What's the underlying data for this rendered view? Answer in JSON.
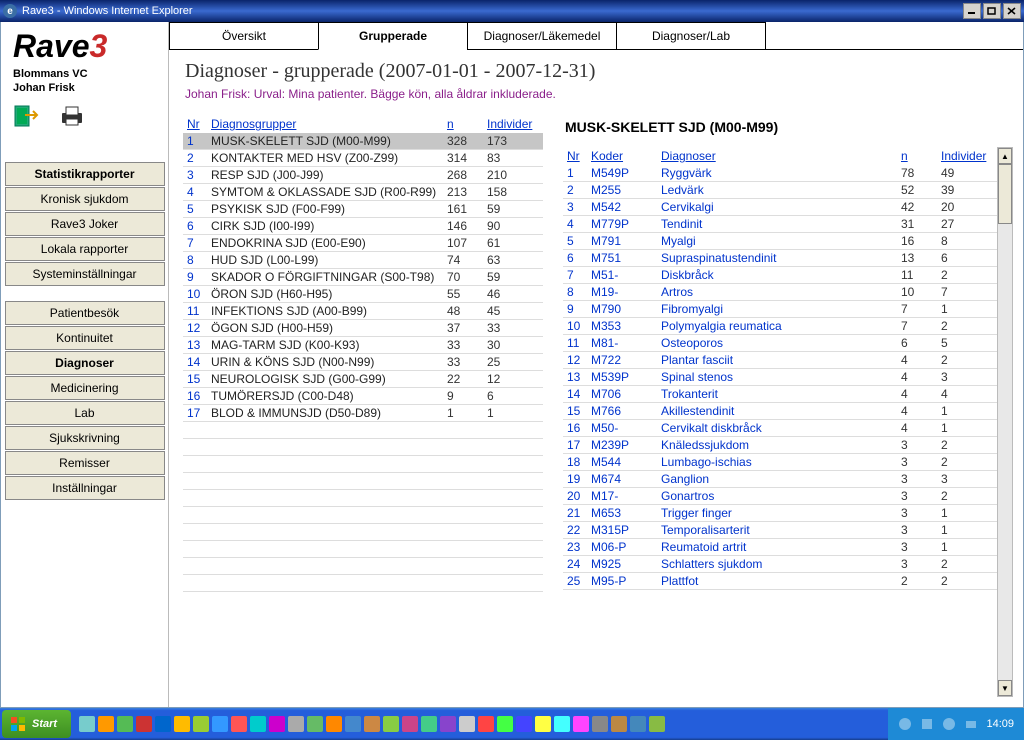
{
  "window": {
    "title": "Rave3 - Windows Internet Explorer"
  },
  "logo": {
    "name": "Rave",
    "suffix": "3"
  },
  "org": {
    "line1": "Blommans VC",
    "line2": "Johan Frisk"
  },
  "tabs": [
    "Översikt",
    "Grupperade",
    "Diagnoser/Läkemedel",
    "Diagnoser/Lab"
  ],
  "active_tab": 1,
  "page_title": "Diagnoser - grupperade (2007-01-01 - 2007-12-31)",
  "page_sub": "Johan Frisk: Urval: Mina patienter. Bägge kön, alla åldrar inkluderade.",
  "nav": {
    "g1": [
      "Statistikrapporter",
      "Kronisk sjukdom",
      "Rave3 Joker",
      "Lokala rapporter",
      "Systeminställningar"
    ],
    "g2": [
      "Patientbesök",
      "Kontinuitet",
      "Diagnoser",
      "Medicinering",
      "Lab",
      "Sjukskrivning",
      "Remisser",
      "Inställningar"
    ],
    "active": "Diagnoser",
    "bold_also": "Statistikrapporter"
  },
  "left_headers": {
    "nr": "Nr",
    "name": "Diagnosgrupper",
    "n": "n",
    "ind": "Individer"
  },
  "left_rows": [
    {
      "nr": 1,
      "name": "MUSK-SKELETT SJD (M00-M99)",
      "n": 328,
      "ind": 173,
      "selected": true
    },
    {
      "nr": 2,
      "name": "KONTAKTER MED HSV (Z00-Z99)",
      "n": 314,
      "ind": 83
    },
    {
      "nr": 3,
      "name": "RESP SJD (J00-J99)",
      "n": 268,
      "ind": 210
    },
    {
      "nr": 4,
      "name": "SYMTOM & OKLASSADE SJD (R00-R99)",
      "n": 213,
      "ind": 158
    },
    {
      "nr": 5,
      "name": "PSYKISK SJD (F00-F99)",
      "n": 161,
      "ind": 59
    },
    {
      "nr": 6,
      "name": "CIRK SJD (I00-I99)",
      "n": 146,
      "ind": 90
    },
    {
      "nr": 7,
      "name": "ENDOKRINA SJD (E00-E90)",
      "n": 107,
      "ind": 61
    },
    {
      "nr": 8,
      "name": "HUD SJD (L00-L99)",
      "n": 74,
      "ind": 63
    },
    {
      "nr": 9,
      "name": "SKADOR O FÖRGIFTNINGAR (S00-T98)",
      "n": 70,
      "ind": 59
    },
    {
      "nr": 10,
      "name": "ÖRON SJD (H60-H95)",
      "n": 55,
      "ind": 46
    },
    {
      "nr": 11,
      "name": "INFEKTIONS SJD (A00-B99)",
      "n": 48,
      "ind": 45
    },
    {
      "nr": 12,
      "name": "ÖGON SJD (H00-H59)",
      "n": 37,
      "ind": 33
    },
    {
      "nr": 13,
      "name": "MAG-TARM SJD (K00-K93)",
      "n": 33,
      "ind": 30
    },
    {
      "nr": 14,
      "name": "URIN & KÖNS SJD (N00-N99)",
      "n": 33,
      "ind": 25
    },
    {
      "nr": 15,
      "name": "NEUROLOGISK SJD (G00-G99)",
      "n": 22,
      "ind": 12
    },
    {
      "nr": 16,
      "name": "TUMÖRERSJD (C00-D48)",
      "n": 9,
      "ind": 6
    },
    {
      "nr": 17,
      "name": "BLOD & IMMUNSJD (D50-D89)",
      "n": 1,
      "ind": 1
    }
  ],
  "right_title": "MUSK-SKELETT SJD (M00-M99)",
  "right_headers": {
    "nr": "Nr",
    "code": "Koder",
    "name": "Diagnoser",
    "n": "n",
    "ind": "Individer"
  },
  "right_rows": [
    {
      "nr": 1,
      "code": "M549P",
      "name": "Ryggvärk",
      "n": 78,
      "ind": 49
    },
    {
      "nr": 2,
      "code": "M255",
      "name": "Ledvärk",
      "n": 52,
      "ind": 39
    },
    {
      "nr": 3,
      "code": "M542",
      "name": "Cervikalgi",
      "n": 42,
      "ind": 20
    },
    {
      "nr": 4,
      "code": "M779P",
      "name": "Tendinit",
      "n": 31,
      "ind": 27
    },
    {
      "nr": 5,
      "code": "M791",
      "name": "Myalgi",
      "n": 16,
      "ind": 8
    },
    {
      "nr": 6,
      "code": "M751",
      "name": "Supraspinatustendinit",
      "n": 13,
      "ind": 6
    },
    {
      "nr": 7,
      "code": "M51-",
      "name": "Diskbråck",
      "n": 11,
      "ind": 2
    },
    {
      "nr": 8,
      "code": "M19-",
      "name": "Artros",
      "n": 10,
      "ind": 7
    },
    {
      "nr": 9,
      "code": "M790",
      "name": "Fibromyalgi",
      "n": 7,
      "ind": 1
    },
    {
      "nr": 10,
      "code": "M353",
      "name": "Polymyalgia reumatica",
      "n": 7,
      "ind": 2
    },
    {
      "nr": 11,
      "code": "M81-",
      "name": "Osteoporos",
      "n": 6,
      "ind": 5
    },
    {
      "nr": 12,
      "code": "M722",
      "name": "Plantar fasciit",
      "n": 4,
      "ind": 2
    },
    {
      "nr": 13,
      "code": "M539P",
      "name": "Spinal stenos",
      "n": 4,
      "ind": 3
    },
    {
      "nr": 14,
      "code": "M706",
      "name": "Trokanterit",
      "n": 4,
      "ind": 4
    },
    {
      "nr": 15,
      "code": "M766",
      "name": "Akillestendinit",
      "n": 4,
      "ind": 1
    },
    {
      "nr": 16,
      "code": "M50-",
      "name": "Cervikalt diskbråck",
      "n": 4,
      "ind": 1
    },
    {
      "nr": 17,
      "code": "M239P",
      "name": "Knäledssjukdom",
      "n": 3,
      "ind": 2
    },
    {
      "nr": 18,
      "code": "M544",
      "name": "Lumbago-ischias",
      "n": 3,
      "ind": 2
    },
    {
      "nr": 19,
      "code": "M674",
      "name": "Ganglion",
      "n": 3,
      "ind": 3
    },
    {
      "nr": 20,
      "code": "M17-",
      "name": "Gonartros",
      "n": 3,
      "ind": 2
    },
    {
      "nr": 21,
      "code": "M653",
      "name": "Trigger finger",
      "n": 3,
      "ind": 1
    },
    {
      "nr": 22,
      "code": "M315P",
      "name": "Temporalisarterit",
      "n": 3,
      "ind": 1
    },
    {
      "nr": 23,
      "code": "M06-P",
      "name": "Reumatoid artrit",
      "n": 3,
      "ind": 1
    },
    {
      "nr": 24,
      "code": "M925",
      "name": "Schlatters sjukdom",
      "n": 3,
      "ind": 2
    },
    {
      "nr": 25,
      "code": "M95-P",
      "name": "Plattfot",
      "n": 2,
      "ind": 2
    }
  ],
  "taskbar": {
    "start": "Start",
    "time": "14:09"
  }
}
